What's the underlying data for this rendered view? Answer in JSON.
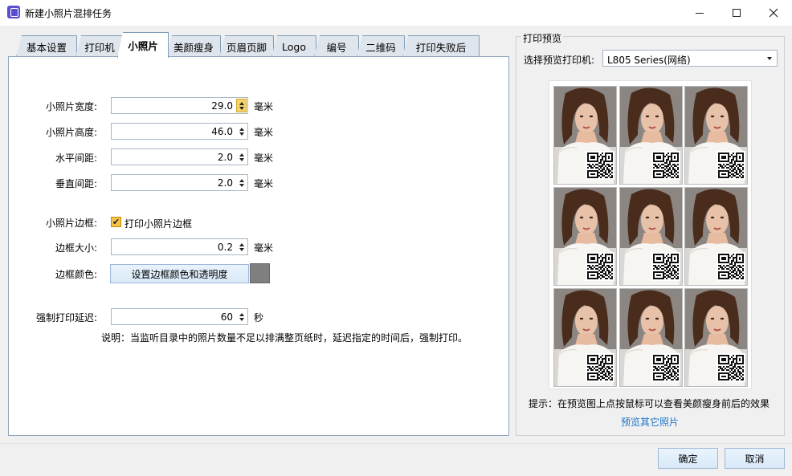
{
  "window": {
    "title": "新建小照片混排任务",
    "minimize_icon": "minimize-icon",
    "maximize_icon": "maximize-icon",
    "close_icon": "close-icon"
  },
  "tabs": [
    {
      "label": "基本设置",
      "active": false
    },
    {
      "label": "打印机",
      "active": false
    },
    {
      "label": "小照片",
      "active": true
    },
    {
      "label": "美颜瘦身",
      "active": false
    },
    {
      "label": "页眉页脚",
      "active": false
    },
    {
      "label": "Logo",
      "active": false
    },
    {
      "label": "编号",
      "active": false
    },
    {
      "label": "二维码",
      "active": false
    },
    {
      "label": "打印失败后",
      "active": false
    }
  ],
  "form": {
    "photo_width": {
      "label": "小照片宽度:",
      "value": "29.0",
      "unit": "毫米"
    },
    "photo_height": {
      "label": "小照片高度:",
      "value": "46.0",
      "unit": "毫米"
    },
    "h_spacing": {
      "label": "水平间距:",
      "value": "2.0",
      "unit": "毫米"
    },
    "v_spacing": {
      "label": "垂直间距:",
      "value": "2.0",
      "unit": "毫米"
    },
    "border": {
      "label": "小照片边框:",
      "checkbox_label": "打印小照片边框",
      "checked": true
    },
    "border_size": {
      "label": "边框大小:",
      "value": "0.2",
      "unit": "毫米"
    },
    "border_color": {
      "label": "边框颜色:",
      "button_label": "设置边框颜色和透明度",
      "swatch_color": "#7f7f7f"
    },
    "print_delay": {
      "label": "强制打印延迟:",
      "value": "60",
      "unit": "秒"
    },
    "note": "说明：当监听目录中的照片数量不足以排满整页纸时，延迟指定的时间后，强制打印。"
  },
  "preview": {
    "group_title": "打印预览",
    "printer_label": "选择预览打印机:",
    "printer_value": "L805 Series(网络)",
    "hint": "提示：在预览图上点按鼠标可以查看美颜瘦身前后的效果",
    "link": "预览其它照片"
  },
  "buttons": {
    "ok": "确定",
    "cancel": "取消"
  }
}
